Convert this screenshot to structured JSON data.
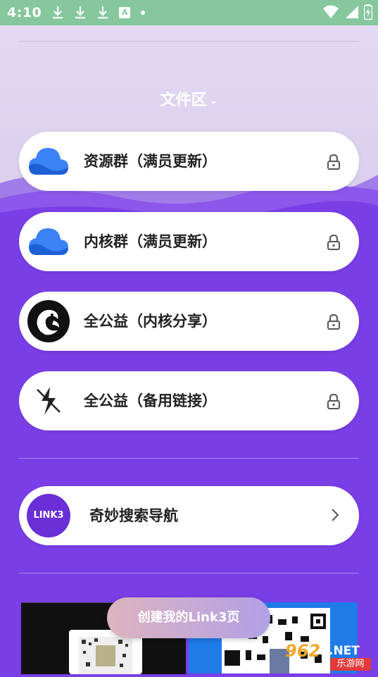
{
  "status_bar": {
    "time": "4:10",
    "left_icons": [
      "download-icon",
      "download-icon",
      "download-icon",
      "font-a-icon",
      "dot-icon"
    ],
    "right_icons": [
      "wifi-icon",
      "signal-icon",
      "battery-charging-icon"
    ],
    "a_glyph": "A"
  },
  "section": {
    "title": "文件区",
    "chevron": "⌄"
  },
  "file_items": [
    {
      "label": "资源群（满员更新）",
      "icon": "cloud-icon",
      "locked": true
    },
    {
      "label": "内核群（满员更新）",
      "icon": "cloud-icon",
      "locked": true
    },
    {
      "label": "全公益（内核分享）",
      "icon": "squirrel-logo-icon",
      "locked": true
    },
    {
      "label": "全公益（备用链接）",
      "icon": "lightning-logo-icon",
      "locked": true
    }
  ],
  "nav_item": {
    "logo_text": "LINK3",
    "label": "奇妙搜索导航",
    "icon": "chevron-right-icon"
  },
  "create_button": {
    "label": "创建我的Link3页"
  },
  "watermark": {
    "number": "962",
    "suffix": ".NET",
    "text": "乐游网"
  },
  "colors": {
    "status_bar": "#86c79e",
    "background": "#7a3ee6",
    "top_background": "#dcd2ee",
    "card": "#ffffff",
    "cloud_blue": "#3b82f6",
    "link3_purple": "#6a2fd6"
  }
}
